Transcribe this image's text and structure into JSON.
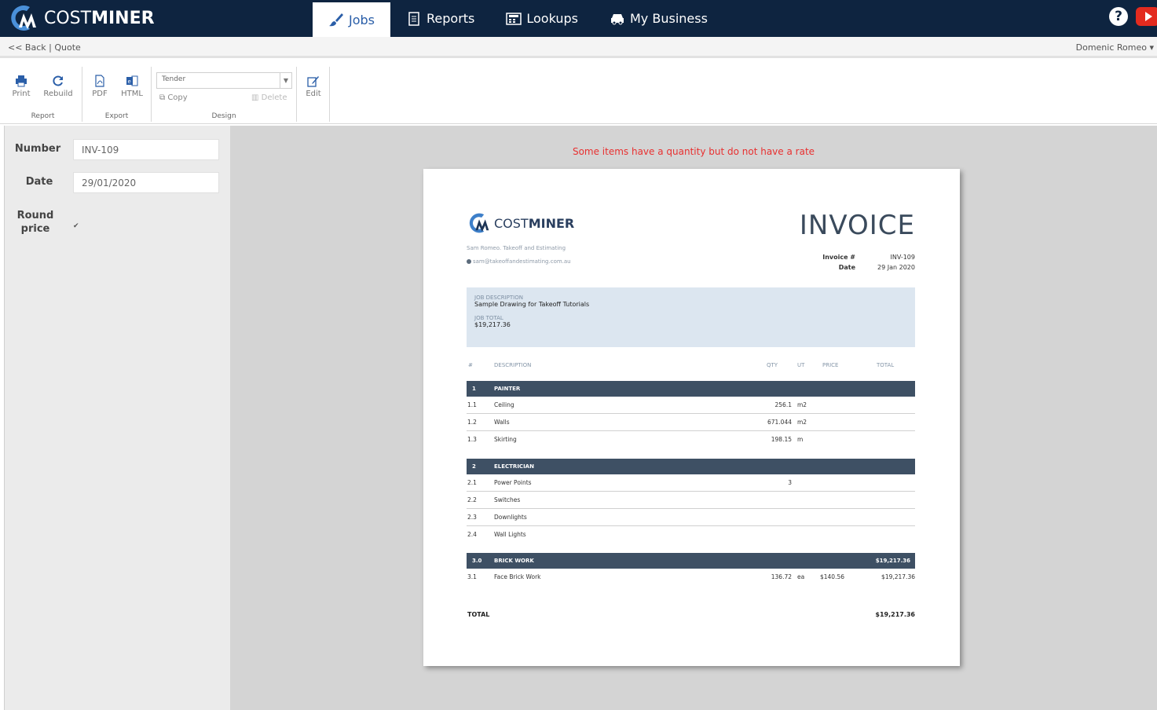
{
  "brand": {
    "logo_thin": "COST",
    "logo_bold": "MINER"
  },
  "nav": [
    {
      "label": "Jobs",
      "icon": "brush-icon",
      "active": true
    },
    {
      "label": "Reports",
      "icon": "document-icon",
      "active": false
    },
    {
      "label": "Lookups",
      "icon": "calculator-icon",
      "active": false
    },
    {
      "label": "My Business",
      "icon": "car-icon",
      "active": false
    }
  ],
  "help_label": "?",
  "subbar": {
    "back": "<< Back",
    "separator": "|",
    "page": "Quote",
    "user": "Domenic Romeo ▾"
  },
  "ribbon": {
    "print": "Print",
    "rebuild": "Rebuild",
    "group_report": "Report",
    "pdf": "PDF",
    "html": "HTML",
    "group_export": "Export",
    "design_select": "Tender",
    "copy": "Copy",
    "delete": "Delete",
    "group_design": "Design",
    "edit": "Edit"
  },
  "form": {
    "number_label": "Number",
    "number_value": "INV-109",
    "date_label": "Date",
    "date_value": "29/01/2020",
    "round_label_1": "Round",
    "round_label_2": "price",
    "round_checked": "✔"
  },
  "warning": "Some items have a quantity but do not have a rate",
  "invoice": {
    "logo_thin": "COST",
    "logo_bold": "MINER",
    "company": "Sam Romeo. Takeoff and Estimating",
    "email": "sam@takeoffandestimating.com.au",
    "title": "INVOICE",
    "invoice_no_label": "Invoice #",
    "invoice_no": "INV-109",
    "date_label": "Date",
    "date": "29 Jan 2020",
    "job_desc_label": "JOB DESCRIPTION",
    "job_desc": "Sample Drawing for Takeoff Tutorials",
    "job_total_label": "JOB TOTAL",
    "job_total": "$19,217.36",
    "columns": {
      "num": "#",
      "desc": "DESCRIPTION",
      "qty": "QTY",
      "ut": "UT",
      "price": "PRICE",
      "total": "TOTAL"
    },
    "sections": [
      {
        "num": "1",
        "name": "PAINTER",
        "total": "",
        "items": [
          {
            "num": "1.1",
            "desc": "Ceiling",
            "qty": "256.1",
            "ut": "m2",
            "price": "",
            "total": ""
          },
          {
            "num": "1.2",
            "desc": "Walls",
            "qty": "671.044",
            "ut": "m2",
            "price": "",
            "total": ""
          },
          {
            "num": "1.3",
            "desc": "Skirting",
            "qty": "198.15",
            "ut": "m",
            "price": "",
            "total": ""
          }
        ]
      },
      {
        "num": "2",
        "name": "ELECTRICIAN",
        "total": "",
        "items": [
          {
            "num": "2.1",
            "desc": "Power Points",
            "qty": "3",
            "ut": "",
            "price": "",
            "total": ""
          },
          {
            "num": "2.2",
            "desc": "Switches",
            "qty": "",
            "ut": "",
            "price": "",
            "total": ""
          },
          {
            "num": "2.3",
            "desc": "Downlights",
            "qty": "",
            "ut": "",
            "price": "",
            "total": ""
          },
          {
            "num": "2.4",
            "desc": "Wall Lights",
            "qty": "",
            "ut": "",
            "price": "",
            "total": ""
          }
        ]
      },
      {
        "num": "3.0",
        "name": "BRICK WORK",
        "total": "$19,217.36",
        "items": [
          {
            "num": "3.1",
            "desc": "Face Brick Work",
            "qty": "136.72",
            "ut": "ea",
            "price": "$140.56",
            "total": "$19,217.36"
          }
        ]
      }
    ],
    "total_label": "TOTAL",
    "total": "$19,217.36"
  },
  "colors": {
    "navbar": "#0e2440",
    "accent": "#2a5ea8",
    "section_row": "#3e5064",
    "warning": "#e83030",
    "job_box": "#dce6f0"
  }
}
